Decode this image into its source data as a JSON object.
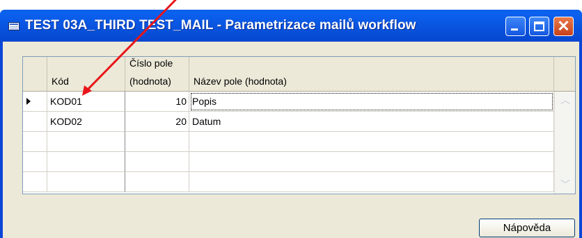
{
  "window": {
    "title": "TEST 03A_THIRD TEST_MAIL - Parametrizace mailů workflow",
    "icon": "form-icon",
    "controls": {
      "minimize": "minimize-icon",
      "maximize": "maximize-icon",
      "close_glyph": "✕"
    }
  },
  "grid": {
    "columns": [
      {
        "line1": "",
        "line2": "Kód"
      },
      {
        "line1": "Číslo pole",
        "line2": "(hodnota)"
      },
      {
        "line1": "",
        "line2": "Název pole (hodnota)"
      }
    ],
    "rows": [
      {
        "code": "KOD01",
        "number": "10",
        "name": "Popis",
        "current": true
      },
      {
        "code": "KOD02",
        "number": "20",
        "name": "Datum",
        "current": false
      },
      {
        "code": "",
        "number": "",
        "name": ""
      },
      {
        "code": "",
        "number": "",
        "name": ""
      },
      {
        "code": "",
        "number": "",
        "name": ""
      }
    ]
  },
  "buttons": {
    "help": "Nápověda"
  },
  "annotation": {
    "color": "#e8161a",
    "meaning": "red arrow pointing at KOD01"
  },
  "colors": {
    "titlebar": "#0a55e0",
    "client_background": "#ece9d8",
    "close_button": "#d2552a"
  }
}
